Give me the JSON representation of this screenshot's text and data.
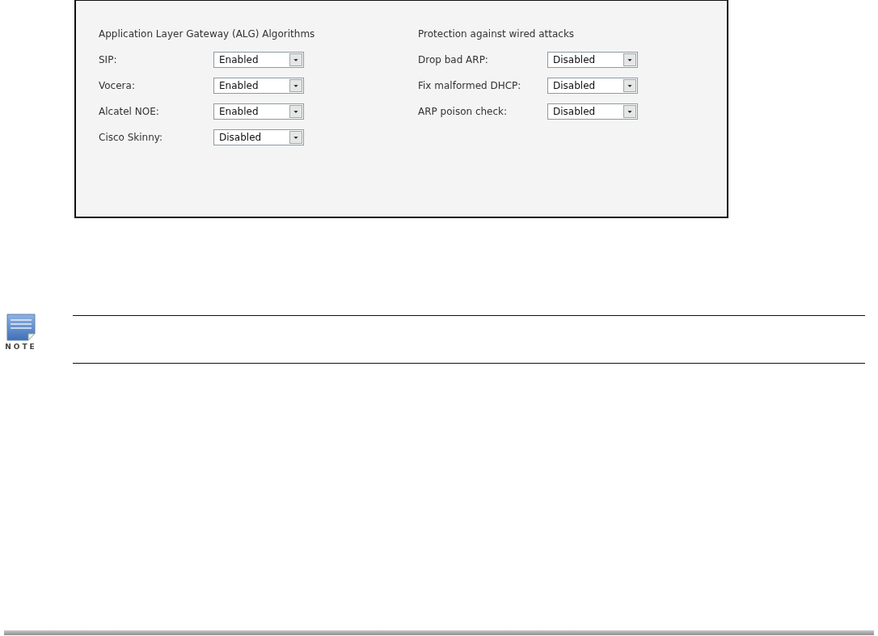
{
  "sections": [
    {
      "heading": "Application Layer Gateway (ALG) Algorithms",
      "fields": [
        {
          "label": "SIP:",
          "value": "Enabled"
        },
        {
          "label": "Vocera:",
          "value": "Enabled"
        },
        {
          "label": "Alcatel NOE:",
          "value": "Enabled"
        },
        {
          "label": "Cisco Skinny:",
          "value": "Disabled"
        }
      ]
    },
    {
      "heading": "Protection against wired attacks",
      "fields": [
        {
          "label": "Drop bad ARP:",
          "value": "Disabled"
        },
        {
          "label": "Fix malformed DHCP:",
          "value": "Disabled"
        },
        {
          "label": "ARP poison check:",
          "value": "Disabled"
        }
      ]
    }
  ],
  "note": {
    "label": "NOTE"
  }
}
